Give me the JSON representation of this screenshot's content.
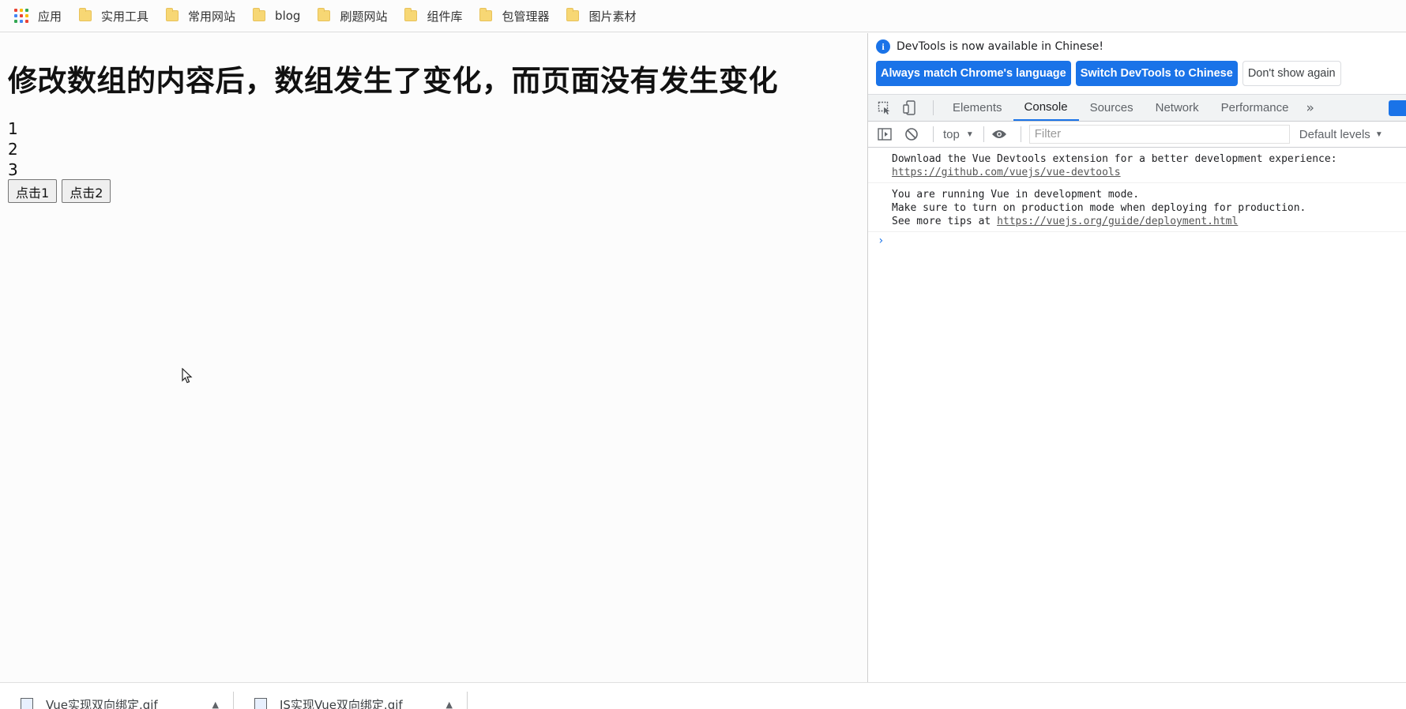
{
  "bookmarks": {
    "apps_label": "应用",
    "items": [
      "实用工具",
      "常用网站",
      "blog",
      "刷题网站",
      "组件库",
      "包管理器",
      "图片素材"
    ]
  },
  "page": {
    "heading": "修改数组的内容后，数组发生了变化，而页面没有发生变化",
    "list": [
      "1",
      "2",
      "3"
    ],
    "buttons": [
      "点击1",
      "点击2"
    ]
  },
  "devtools": {
    "info_text": "DevTools is now available in Chinese!",
    "info_buttons": {
      "match": "Always match Chrome's language",
      "switch": "Switch DevTools to Chinese",
      "dismiss": "Don't show again"
    },
    "tabs": [
      "Elements",
      "Console",
      "Sources",
      "Network",
      "Performance"
    ],
    "active_tab": "Console",
    "more_tabs_icon": "»",
    "context": "top",
    "filter_placeholder": "Filter",
    "levels": "Default levels",
    "messages": {
      "m1_line1": "Download the Vue Devtools extension for a better development experience:",
      "m1_link": "https://github.com/vuejs/vue-devtools",
      "m2_line1": "You are running Vue in development mode.",
      "m2_line2": "Make sure to turn on production mode when deploying for production.",
      "m2_prefix": "See more tips at ",
      "m2_link": "https://vuejs.org/guide/deployment.html"
    },
    "prompt": "›"
  },
  "downloads": [
    "Vue实现双向绑定.gif",
    "JS实现Vue双向绑定.gif"
  ],
  "colors": {
    "accent": "#1a73e8",
    "folder": "#f7d774"
  }
}
